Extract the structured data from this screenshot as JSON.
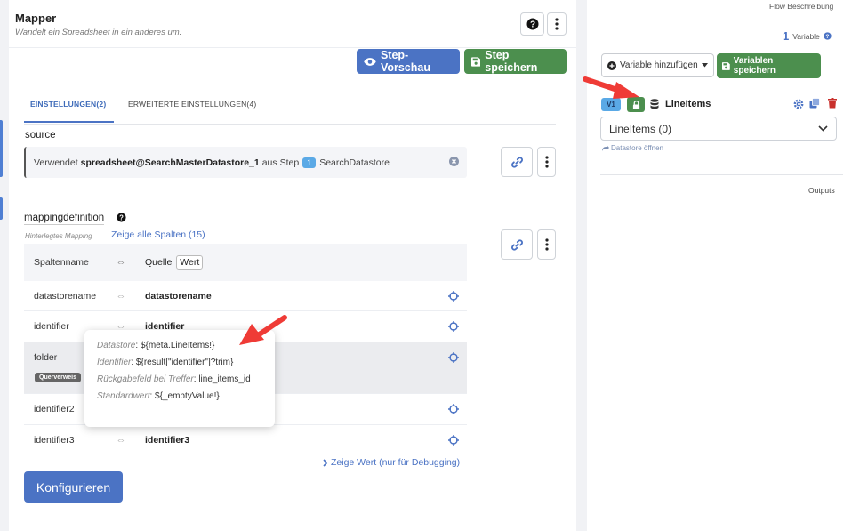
{
  "mapper": {
    "title": "Mapper",
    "subtitle": "Wandelt ein Spreadsheet in ein anderes um.",
    "help_icon": "question-circle-icon",
    "menu_icon": "vertical-dots-icon"
  },
  "toolbar": {
    "preview_label": "Step-Vorschau",
    "save_label": "Step speichern"
  },
  "tabs": [
    {
      "label": "EINSTELLUNGEN(2)",
      "active": true
    },
    {
      "label": "ERWEITERTE EINSTELLUNGEN(4)",
      "active": false
    }
  ],
  "source": {
    "label": "source",
    "text_prefix": "Verwendet",
    "var_name": "spreadsheet@SearchMasterDatastore_1",
    "text_mid": "aus Step",
    "step_num": "1",
    "step_name": "SearchDatastore"
  },
  "mapping": {
    "label": "mappingdefinition",
    "hint": "Hinterlegtes Mapping",
    "show_all": "Zeige alle Spalten (15)",
    "header": {
      "col1": "Spaltenname",
      "eq": "⇔",
      "col2": "Quelle",
      "col2_tag": "Wert"
    },
    "rows": [
      {
        "name": "datastorename",
        "eq": "⇔",
        "value": "datastorename"
      },
      {
        "name": "identifier",
        "eq": "⇔",
        "value": "identifier"
      },
      {
        "name": "folder",
        "eq": "",
        "value": "",
        "badge": "Querverweis"
      },
      {
        "name": "identifier2",
        "eq": "",
        "value": ""
      },
      {
        "name": "identifier3",
        "eq": "⇔",
        "value": "identifier3"
      }
    ],
    "debug_link": "Zeige Wert (nur für Debugging)"
  },
  "tooltip": {
    "lines": [
      {
        "key": "Datastore",
        "value": "${meta.LineItems!}"
      },
      {
        "key": "Identifier",
        "value": "${result[\"identifier\"]?trim}"
      },
      {
        "key": "Rückgabefeld bei Treffer",
        "value": "line_items_id"
      },
      {
        "key": "Standardwert",
        "value": "${_emptyValue!}"
      }
    ]
  },
  "configure_label": "Konfigurieren",
  "right": {
    "flow_title": "Flow Beschreibung",
    "var_count": "1",
    "var_label": "Variable",
    "add_var_label": "Variable hinzufügen",
    "save_vars_label": "Variablen speichern",
    "var_badge": "V1",
    "var_name": "LineItems",
    "select_value": "LineItems (0)",
    "open_datastore": "Datastore öffnen",
    "outputs_label": "Outputs"
  },
  "colors": {
    "accent_blue": "#4b73c4",
    "accent_green": "#4c8f4e",
    "delete_red": "#c9302c",
    "annotation_red": "#ef3b36",
    "badge_cyan": "#5aa9e6"
  }
}
